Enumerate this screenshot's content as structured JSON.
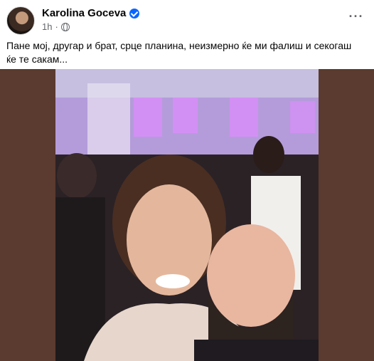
{
  "post": {
    "author": "Karolina Goceva",
    "time": "1h",
    "separator": "·",
    "more_label": "···",
    "caption": "Пане мој, другар и брат, срце планина, неизмерно ќе ми фалиш и секогаш ќе те сакам..."
  },
  "colors": {
    "verified": "#0866ff",
    "photo_backdrop": "#5b3a2f",
    "stage_light": "#c95cf0"
  },
  "icons": [
    "avatar",
    "verified-icon",
    "globe-icon",
    "more-icon"
  ]
}
